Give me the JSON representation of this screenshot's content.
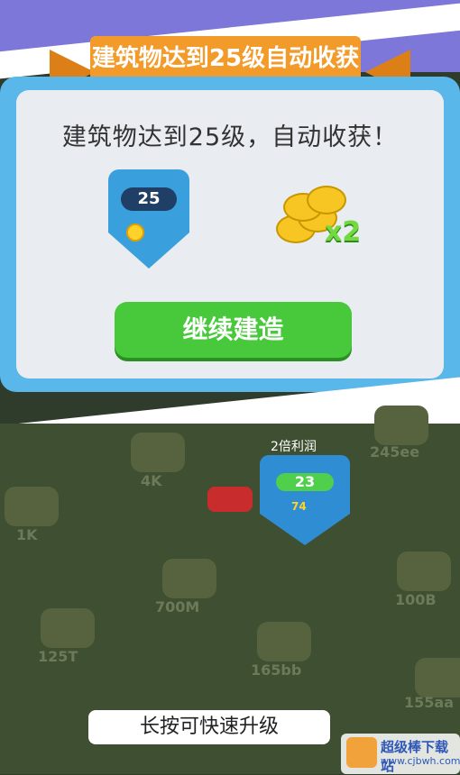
{
  "dialog": {
    "ribbon_title": "建筑物达到25级自动收获",
    "message": "建筑物达到25级，自动收获！",
    "level_badge": "25",
    "reward_multiplier": "x2",
    "continue_button": "继续建造"
  },
  "gameboard": {
    "plot_values": [
      "4K",
      "245ee",
      "1K",
      "700M",
      "100B",
      "125T",
      "165bb",
      "155aa"
    ],
    "profit_label": "2倍利润",
    "building_level": "23",
    "building_income": "74"
  },
  "hint": "长按可快速升级",
  "watermark": {
    "title": "超级棒下载站",
    "url": "www.cjbwh.com"
  },
  "colors": {
    "top_background": "#7d77d9",
    "dialog_blue": "#5ab7ea",
    "button_green": "#48c83b",
    "ribbon_orange": "#f39b2a"
  }
}
